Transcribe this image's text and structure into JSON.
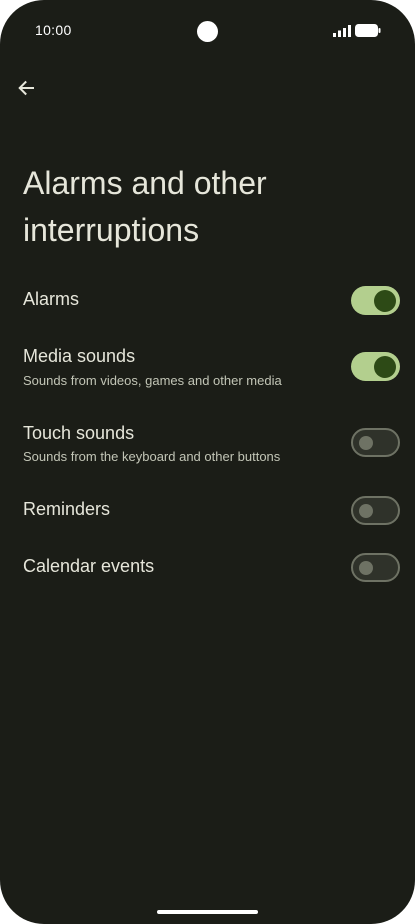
{
  "status_bar": {
    "time": "10:00"
  },
  "icons": {
    "back": "arrow-back-icon",
    "signal": "signal-icon",
    "battery": "battery-icon"
  },
  "page": {
    "title": "Alarms and other interruptions"
  },
  "settings": [
    {
      "title": "Alarms",
      "subtitle": "",
      "enabled": true
    },
    {
      "title": "Media sounds",
      "subtitle": "Sounds from videos, games and other media",
      "enabled": true
    },
    {
      "title": "Touch sounds",
      "subtitle": "Sounds from the keyboard and other buttons",
      "enabled": false
    },
    {
      "title": "Reminders",
      "subtitle": "",
      "enabled": false
    },
    {
      "title": "Calendar events",
      "subtitle": "",
      "enabled": false
    }
  ],
  "colors": {
    "background": "#1b1d17",
    "switch_on_track": "#b3cf8e",
    "switch_on_thumb": "#2d4a16",
    "switch_off_outline": "#6e7264",
    "text_primary": "#e6e6da",
    "text_secondary": "#c2c5b6"
  }
}
